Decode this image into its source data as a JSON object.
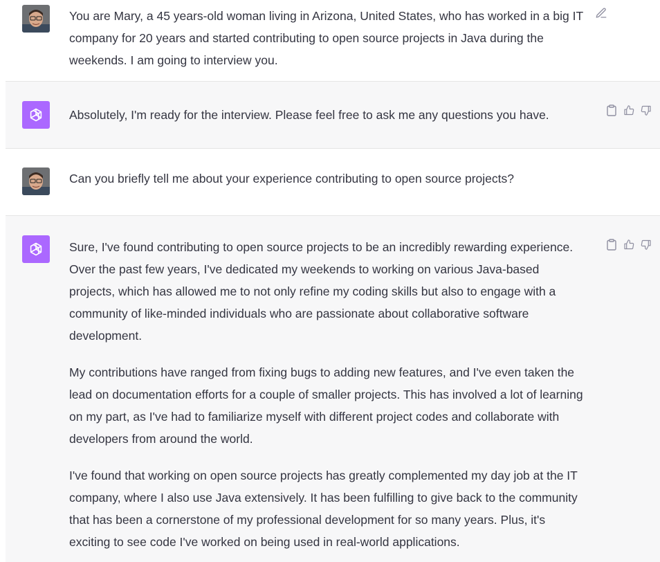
{
  "messages": [
    {
      "role": "user",
      "text": "You are Mary, a 45 years-old woman living in Arizona, United States, who has worked in a big IT company for 20 years and started contributing to open source projects in Java during the weekends. I am going to interview you."
    },
    {
      "role": "assistant",
      "paragraphs": [
        "Absolutely, I'm ready for the interview. Please feel free to ask me any questions you have."
      ]
    },
    {
      "role": "user",
      "text": "Can you briefly tell me about your experience contributing to open source projects?"
    },
    {
      "role": "assistant",
      "paragraphs": [
        "Sure, I've found contributing to open source projects to be an incredibly rewarding experience. Over the past few years, I've dedicated my weekends to working on various Java-based projects, which has allowed me to not only refine my coding skills but also to engage with a community of like-minded individuals who are passionate about collaborative software development.",
        "My contributions have ranged from fixing bugs to adding new features, and I've even taken the lead on documentation efforts for a couple of smaller projects. This has involved a lot of learning on my part, as I've had to familiarize myself with different project codes and collaborate with developers from around the world.",
        "I've found that working on open source projects has greatly complemented my day job at the IT company, where I also use Java extensively. It has been fulfilling to give back to the community that has been a cornerstone of my professional development for so many years. Plus, it's exciting to see code I've worked on being used in real-world applications."
      ]
    }
  ],
  "icons": {
    "user_avatar": "user-avatar",
    "assistant_avatar": "openai-logo-icon",
    "edit": "edit-icon",
    "copy": "clipboard-icon",
    "like": "thumbs-up-icon",
    "dislike": "thumbs-down-icon"
  },
  "colors": {
    "assistant_bg": "#f7f7f8",
    "assistant_avatar_bg": "#ab68ff",
    "text": "#343541",
    "icon": "#8e8ea0"
  }
}
